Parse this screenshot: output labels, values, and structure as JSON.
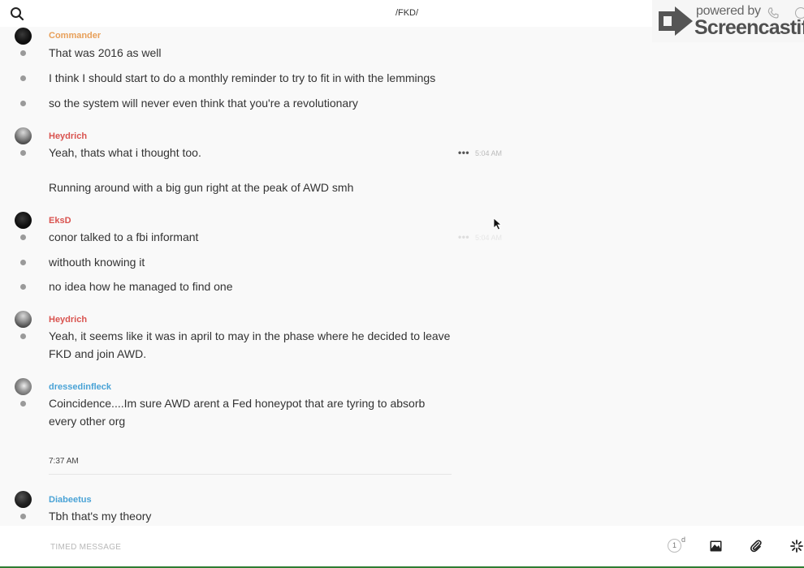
{
  "header": {
    "title": "/FKD/",
    "search_icon": "search-icon"
  },
  "watermark": {
    "small": "powered by",
    "brand": "Screencastify"
  },
  "messages": [
    {
      "user": "Commander",
      "user_color": "#e8a05a",
      "lines": [
        "That was 2016 as well",
        "I think I should start to do a monthly reminder to try to fit in with the lemmings",
        "so the system will never even think that you're a revolutionary"
      ]
    },
    {
      "user": "Heydrich",
      "user_color": "#d9534f",
      "lines": [
        "Yeah, thats what i thought too.",
        "Running around with a big gun right at the peak of AWD smh"
      ],
      "more_label": "•••",
      "timestamp": "5:04 AM"
    },
    {
      "user": "EksD",
      "user_color": "#d9534f",
      "lines": [
        "conor talked to a fbi informant",
        "withouth knowing it",
        "no idea how he managed to find one"
      ],
      "more_label": "•••",
      "timestamp": "5:04 AM"
    },
    {
      "user": "Heydrich",
      "user_color": "#d9534f",
      "lines": [
        "Yeah, it seems like it was in april to may in the phase where he decided to leave FKD and join AWD."
      ]
    },
    {
      "user": "dressedinfleck",
      "user_color": "#4aa3d6",
      "lines": [
        "Coincidence....Im sure AWD arent a Fed honeypot that are tyring to absorb every other org"
      ]
    },
    {
      "user": "Diabeetus",
      "user_color": "#4aa3d6",
      "lines": [
        "Tbh that's my theory"
      ]
    }
  ],
  "time_divider": "7:37 AM",
  "composer": {
    "placeholder": "TIMED MESSAGE",
    "timer_value": "1",
    "timer_unit": "d"
  }
}
